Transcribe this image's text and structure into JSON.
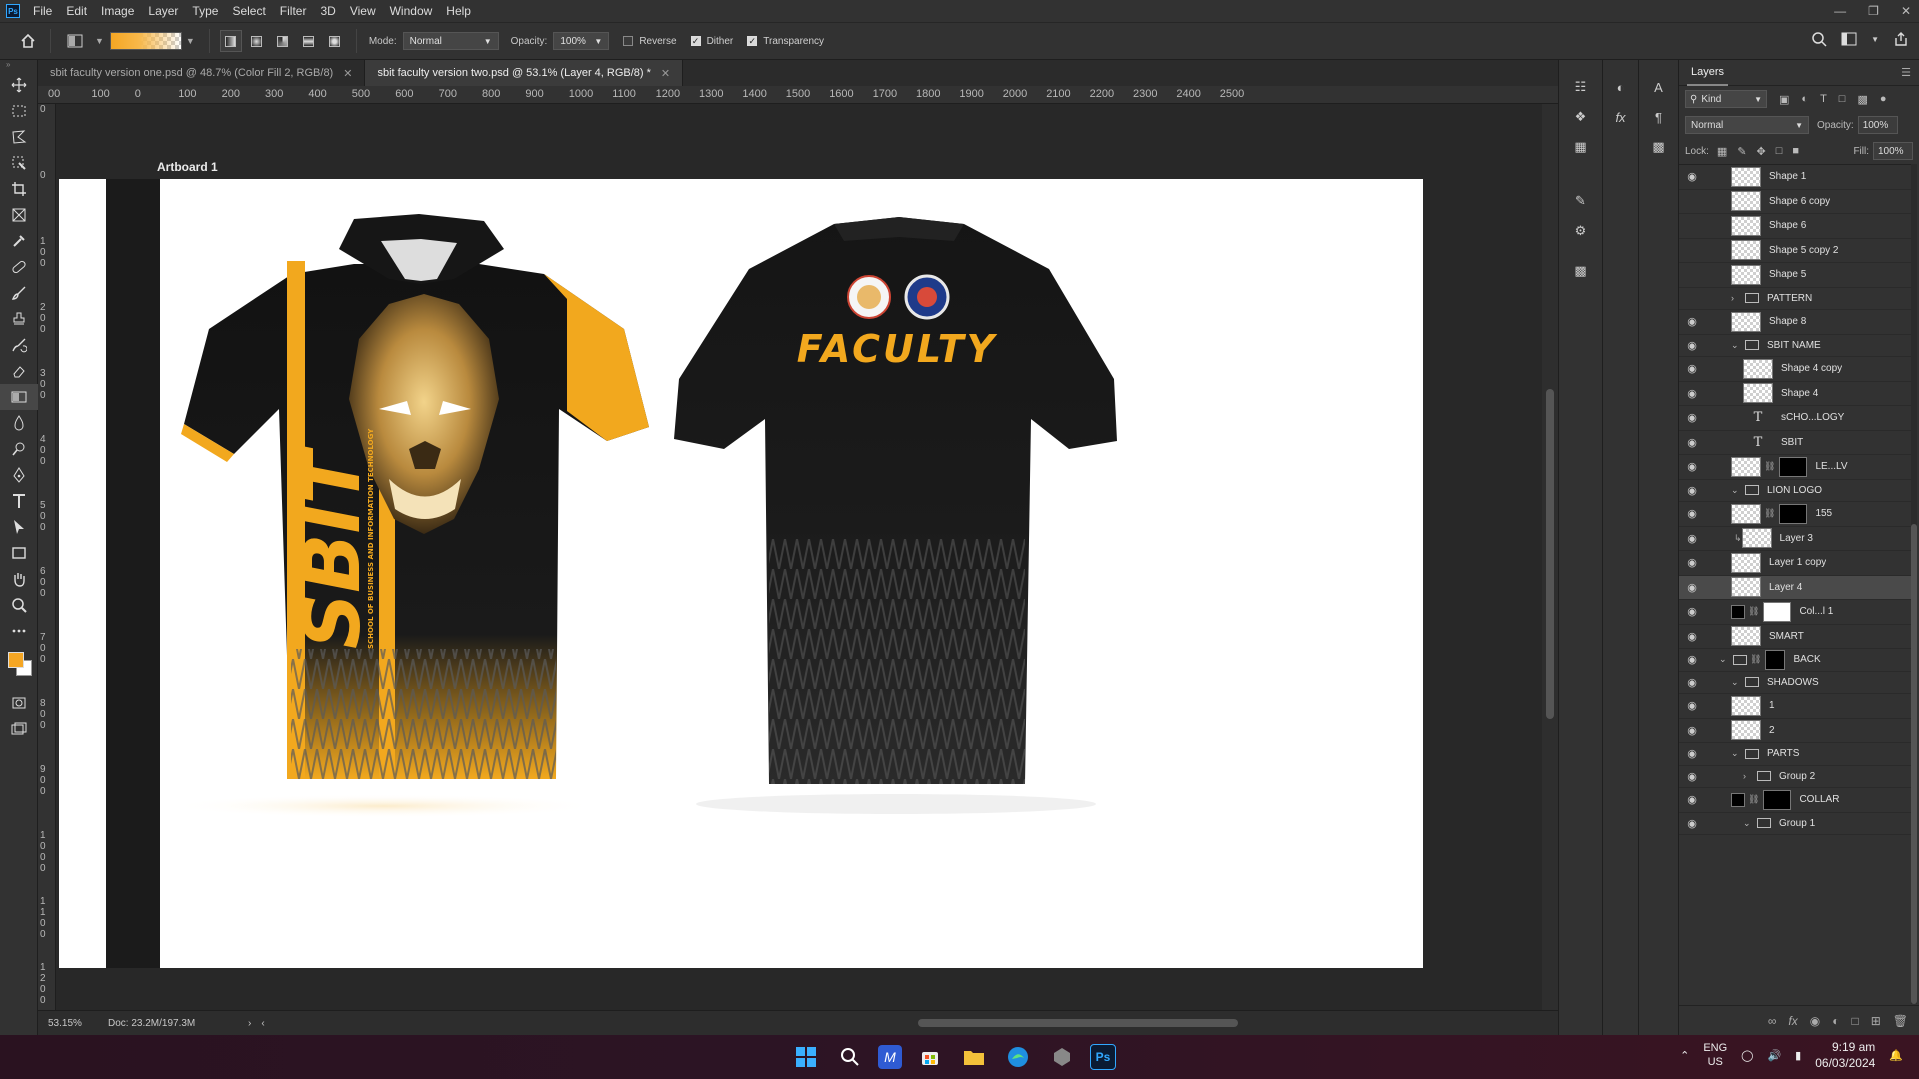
{
  "menubar": {
    "app_icon": "Ps",
    "items": [
      "File",
      "Edit",
      "Image",
      "Layer",
      "Type",
      "Select",
      "Filter",
      "3D",
      "View",
      "Window",
      "Help"
    ]
  },
  "options": {
    "mode_label": "Mode:",
    "mode_value": "Normal",
    "opacity_label": "Opacity:",
    "opacity_value": "100%",
    "reverse_label": "Reverse",
    "dither_label": "Dither",
    "transparency_label": "Transparency",
    "gradient_colors": [
      "#f5a623",
      "#ffffff"
    ]
  },
  "tabs": [
    {
      "label": "sbit faculty version one.psd @ 48.7% (Color Fill 2, RGB/8)"
    },
    {
      "label": "sbit faculty version two.psd @ 53.1% (Layer 4, RGB/8) *"
    }
  ],
  "rulers": {
    "top": [
      "00",
      "100",
      "0",
      "100",
      "200",
      "300",
      "400",
      "500",
      "600",
      "700",
      "800",
      "900",
      "1000",
      "1100",
      "1200",
      "1300",
      "1400",
      "1500",
      "1600",
      "1700",
      "1800",
      "1900",
      "2000",
      "2100",
      "2200",
      "2300",
      "2400",
      "2500"
    ],
    "left": [
      "0",
      "0",
      "100",
      "200",
      "300",
      "400",
      "500",
      "600",
      "700",
      "800",
      "900",
      "1000",
      "1100",
      "1200",
      "1300"
    ]
  },
  "artboard": {
    "label": "Artboard 1",
    "front_text": "SBIT",
    "front_subtext": "SCHOOL OF BUSINESS AND INFORMATION TECHNOLOGY",
    "back_text": "FACULTY"
  },
  "statusbar": {
    "zoom": "53.15%",
    "doc": "Doc: 23.2M/197.3M"
  },
  "layers_panel": {
    "title": "Layers",
    "kind_label": "Kind",
    "blend_mode": "Normal",
    "opacity_label": "Opacity:",
    "opacity_value": "100%",
    "lock_label": "Lock:",
    "fill_label": "Fill:",
    "fill_value": "100%",
    "layers": [
      {
        "name": "Shape 1",
        "type": "shape",
        "visible": true,
        "indent": 1
      },
      {
        "name": "Shape 6 copy",
        "type": "shape",
        "visible": false,
        "indent": 1
      },
      {
        "name": "Shape 6",
        "type": "shape",
        "visible": false,
        "indent": 1
      },
      {
        "name": "Shape 5 copy 2",
        "type": "shape",
        "visible": false,
        "indent": 1
      },
      {
        "name": "Shape 5",
        "type": "shape",
        "visible": false,
        "indent": 1
      },
      {
        "name": "PATTERN",
        "type": "group",
        "visible": false,
        "indent": 1,
        "open": false
      },
      {
        "name": "Shape 8",
        "type": "shape",
        "visible": true,
        "indent": 1
      },
      {
        "name": "SBIT NAME",
        "type": "group",
        "visible": true,
        "indent": 1,
        "open": true
      },
      {
        "name": "Shape 4 copy",
        "type": "shape",
        "visible": true,
        "indent": 2
      },
      {
        "name": "Shape 4",
        "type": "shape",
        "visible": true,
        "indent": 2
      },
      {
        "name": "sCHO...LOGY",
        "type": "text",
        "visible": true,
        "indent": 2
      },
      {
        "name": "SBIT",
        "type": "text",
        "visible": true,
        "indent": 2
      },
      {
        "name": "LE...LV",
        "type": "masked",
        "visible": true,
        "indent": 1
      },
      {
        "name": "LION LOGO",
        "type": "group",
        "visible": true,
        "indent": 1,
        "open": true
      },
      {
        "name": "155",
        "type": "masked",
        "visible": true,
        "indent": 1
      },
      {
        "name": "Layer 3",
        "type": "clip",
        "visible": true,
        "indent": 1
      },
      {
        "name": "Layer 1 copy",
        "type": "pixel",
        "visible": true,
        "indent": 1
      },
      {
        "name": "Layer 4",
        "type": "pixel",
        "visible": true,
        "indent": 1,
        "selected": true
      },
      {
        "name": "Col...l 1",
        "type": "fill",
        "visible": true,
        "indent": 1
      },
      {
        "name": "SMART",
        "type": "smart",
        "visible": true,
        "indent": 1
      },
      {
        "name": "BACK",
        "type": "group-masked",
        "visible": true,
        "indent": 0,
        "open": true
      },
      {
        "name": "SHADOWS",
        "type": "group",
        "visible": true,
        "indent": 1,
        "open": true
      },
      {
        "name": "1",
        "type": "pixel",
        "visible": true,
        "indent": 1
      },
      {
        "name": "2",
        "type": "pixel",
        "visible": true,
        "indent": 1
      },
      {
        "name": "PARTS",
        "type": "group",
        "visible": true,
        "indent": 1,
        "open": true
      },
      {
        "name": "Group 2",
        "type": "group",
        "visible": true,
        "indent": 2,
        "open": false
      },
      {
        "name": "COLLAR",
        "type": "fill",
        "visible": true,
        "indent": 1
      },
      {
        "name": "Group 1",
        "type": "group",
        "visible": true,
        "indent": 2,
        "open": true
      }
    ]
  },
  "taskbar": {
    "lang_line1": "ENG",
    "lang_line2": "US",
    "time": "9:19 am",
    "date": "06/03/2024"
  }
}
